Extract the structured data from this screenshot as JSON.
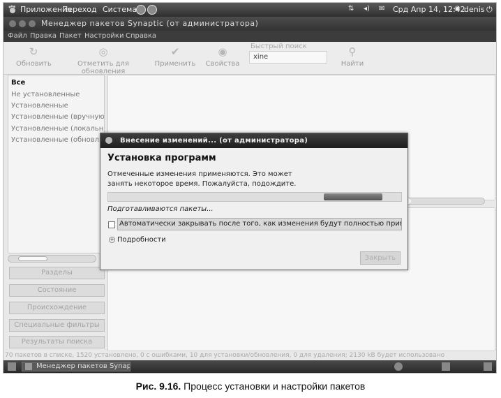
{
  "top_panel": {
    "menus": [
      "Приложения",
      "Переход",
      "Система"
    ],
    "datetime": "Срд Апр 14, 12:42",
    "user": "denis"
  },
  "window": {
    "title": "Менеджер пакетов Synaptic  (от администратора)",
    "menu": [
      "Файл",
      "Правка",
      "Пакет",
      "Настройки",
      "Справка"
    ]
  },
  "toolbar": {
    "reload": "Обновить",
    "mark_all": "Отметить для обновления",
    "apply": "Применить",
    "properties": "Свойства",
    "quick_search_label": "Быстрый поиск",
    "quick_search_value": "xine",
    "search": "Найти"
  },
  "filters": {
    "items": [
      "Все",
      "Не установленные",
      "Установленные",
      "Установленные (вручную)",
      "Установленные (локально или устаревшие)",
      "Установленные (обновляемые)"
    ]
  },
  "side_buttons": [
    "Разделы",
    "Состояние",
    "Происхождение",
    "Специальные фильтры",
    "Результаты поиска"
  ],
  "status_bar": "70 пакетов в списке, 1520 установлено, 0 с ошибками, 10 для установки/обновления, 0 для удаления; 2130 kB будет использовано",
  "taskbar": {
    "task": "Менеджер пакетов Synap..."
  },
  "dialog": {
    "title": "Внесение изменений... (от администратора)",
    "heading": "Установка программ",
    "message_line1": "Отмеченные изменения применяются. Это может",
    "message_line2": "занять некоторое время. Пожалуйста, подождите.",
    "progress": 0.5,
    "status": "Подготавливаются пакеты...",
    "auto_close_label": "Автоматически закрывать после того, как изменения будут полностью применены",
    "auto_close_checked": false,
    "details": "Подробности",
    "close": "Закрыть"
  },
  "caption": {
    "label": "Рис. 9.16.",
    "text": " Процесс установки и настройки пакетов"
  }
}
